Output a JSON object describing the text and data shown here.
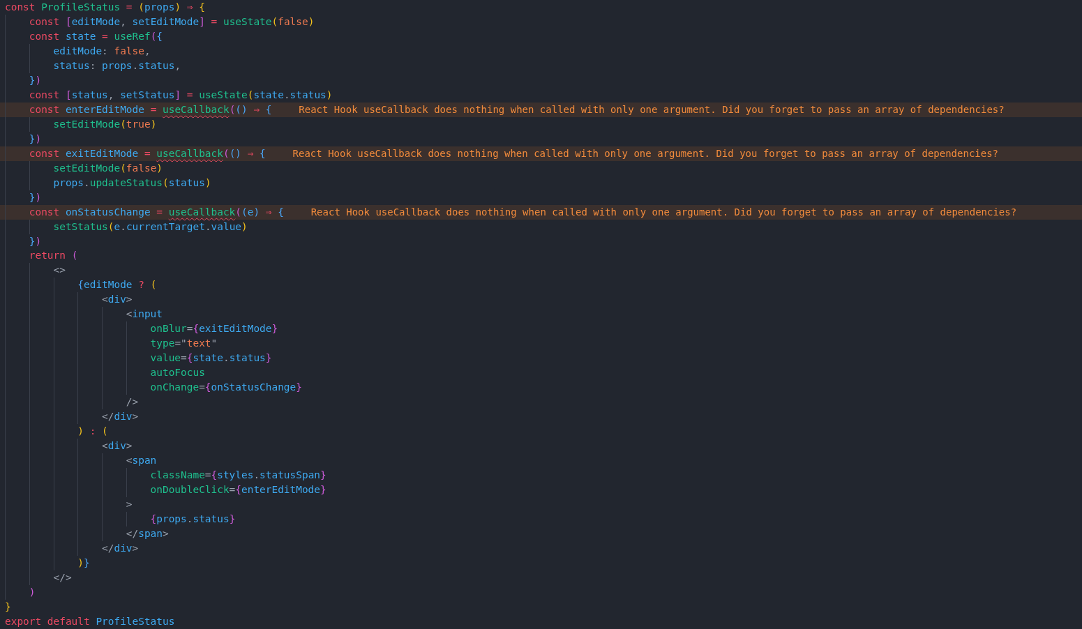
{
  "editor": {
    "lines": [
      {
        "tokens": [
          {
            "text": "const ",
            "kind": "kw"
          },
          {
            "text": "ProfileStatus ",
            "kind": "fn"
          },
          {
            "text": "= ",
            "kind": "op"
          },
          {
            "text": "(",
            "kind": "b1"
          },
          {
            "text": "props",
            "kind": "var"
          },
          {
            "text": ") ",
            "kind": "b1"
          },
          {
            "text": "⇒ ",
            "kind": "op"
          },
          {
            "text": "{",
            "kind": "b1"
          }
        ]
      },
      {
        "tokens": [
          {
            "text": "    const ",
            "kind": "kw"
          },
          {
            "text": "[",
            "kind": "b2"
          },
          {
            "text": "editMode",
            "kind": "var"
          },
          {
            "text": ", ",
            "kind": "punct"
          },
          {
            "text": "setEditMode",
            "kind": "var"
          },
          {
            "text": "] ",
            "kind": "b2"
          },
          {
            "text": "= ",
            "kind": "op"
          },
          {
            "text": "useState",
            "kind": "fn"
          },
          {
            "text": "(",
            "kind": "b1"
          },
          {
            "text": "false",
            "kind": "bool"
          },
          {
            "text": ")",
            "kind": "b1"
          }
        ]
      },
      {
        "tokens": [
          {
            "text": "    const ",
            "kind": "kw"
          },
          {
            "text": "state ",
            "kind": "var"
          },
          {
            "text": "= ",
            "kind": "op"
          },
          {
            "text": "useRef",
            "kind": "fn"
          },
          {
            "text": "(",
            "kind": "b2"
          },
          {
            "text": "{",
            "kind": "b3"
          }
        ]
      },
      {
        "tokens": [
          {
            "text": "        editMode",
            "kind": "var"
          },
          {
            "text": ": ",
            "kind": "punct"
          },
          {
            "text": "false",
            "kind": "bool"
          },
          {
            "text": ",",
            "kind": "punct"
          }
        ]
      },
      {
        "tokens": [
          {
            "text": "        status",
            "kind": "var"
          },
          {
            "text": ": ",
            "kind": "punct"
          },
          {
            "text": "props",
            "kind": "var"
          },
          {
            "text": ".",
            "kind": "punct"
          },
          {
            "text": "status",
            "kind": "var"
          },
          {
            "text": ",",
            "kind": "punct"
          }
        ]
      },
      {
        "tokens": [
          {
            "text": "    }",
            "kind": "b3"
          },
          {
            "text": ")",
            "kind": "b2"
          }
        ]
      },
      {
        "tokens": [
          {
            "text": "    const ",
            "kind": "kw"
          },
          {
            "text": "[",
            "kind": "b2"
          },
          {
            "text": "status",
            "kind": "var"
          },
          {
            "text": ", ",
            "kind": "punct"
          },
          {
            "text": "setStatus",
            "kind": "var"
          },
          {
            "text": "] ",
            "kind": "b2"
          },
          {
            "text": "= ",
            "kind": "op"
          },
          {
            "text": "useState",
            "kind": "fn"
          },
          {
            "text": "(",
            "kind": "b1"
          },
          {
            "text": "state",
            "kind": "var"
          },
          {
            "text": ".",
            "kind": "punct"
          },
          {
            "text": "status",
            "kind": "var"
          },
          {
            "text": ")",
            "kind": "b1"
          }
        ]
      },
      {
        "tokens": [
          {
            "text": "    const ",
            "kind": "kw"
          },
          {
            "text": "enterEditMode ",
            "kind": "var"
          },
          {
            "text": "= ",
            "kind": "op"
          },
          {
            "text": "useCallback",
            "kind": "flagged"
          },
          {
            "text": "(",
            "kind": "b2"
          },
          {
            "text": "() ",
            "kind": "b3"
          },
          {
            "text": "⇒ ",
            "kind": "op"
          },
          {
            "text": "{",
            "kind": "b3"
          }
        ],
        "warning": "React Hook useCallback does nothing when called with only one argument. Did you forget to pass an array of dependencies?"
      },
      {
        "tokens": [
          {
            "text": "        setEditMode",
            "kind": "fn"
          },
          {
            "text": "(",
            "kind": "b1"
          },
          {
            "text": "true",
            "kind": "bool"
          },
          {
            "text": ")",
            "kind": "b1"
          }
        ]
      },
      {
        "tokens": [
          {
            "text": "    }",
            "kind": "b3"
          },
          {
            "text": ")",
            "kind": "b2"
          }
        ]
      },
      {
        "tokens": [
          {
            "text": "    const ",
            "kind": "kw"
          },
          {
            "text": "exitEditMode ",
            "kind": "var"
          },
          {
            "text": "= ",
            "kind": "op"
          },
          {
            "text": "useCallback",
            "kind": "flagged"
          },
          {
            "text": "(",
            "kind": "b2"
          },
          {
            "text": "() ",
            "kind": "b3"
          },
          {
            "text": "⇒ ",
            "kind": "op"
          },
          {
            "text": "{",
            "kind": "b3"
          }
        ],
        "warning": "React Hook useCallback does nothing when called with only one argument. Did you forget to pass an array of dependencies?"
      },
      {
        "tokens": [
          {
            "text": "        setEditMode",
            "kind": "fn"
          },
          {
            "text": "(",
            "kind": "b1"
          },
          {
            "text": "false",
            "kind": "bool"
          },
          {
            "text": ")",
            "kind": "b1"
          }
        ]
      },
      {
        "tokens": [
          {
            "text": "        props",
            "kind": "var"
          },
          {
            "text": ".",
            "kind": "punct"
          },
          {
            "text": "updateStatus",
            "kind": "fn"
          },
          {
            "text": "(",
            "kind": "b1"
          },
          {
            "text": "status",
            "kind": "var"
          },
          {
            "text": ")",
            "kind": "b1"
          }
        ]
      },
      {
        "tokens": [
          {
            "text": "    }",
            "kind": "b3"
          },
          {
            "text": ")",
            "kind": "b2"
          }
        ]
      },
      {
        "tokens": [
          {
            "text": "    const ",
            "kind": "kw"
          },
          {
            "text": "onStatusChange ",
            "kind": "var"
          },
          {
            "text": "= ",
            "kind": "op"
          },
          {
            "text": "useCallback",
            "kind": "flagged"
          },
          {
            "text": "(",
            "kind": "b2"
          },
          {
            "text": "(",
            "kind": "b3"
          },
          {
            "text": "e",
            "kind": "var"
          },
          {
            "text": ") ",
            "kind": "b3"
          },
          {
            "text": "⇒ ",
            "kind": "op"
          },
          {
            "text": "{",
            "kind": "b3"
          }
        ],
        "warning": "React Hook useCallback does nothing when called with only one argument. Did you forget to pass an array of dependencies?"
      },
      {
        "tokens": [
          {
            "text": "        setStatus",
            "kind": "fn"
          },
          {
            "text": "(",
            "kind": "b1"
          },
          {
            "text": "e",
            "kind": "var"
          },
          {
            "text": ".",
            "kind": "punct"
          },
          {
            "text": "currentTarget",
            "kind": "var"
          },
          {
            "text": ".",
            "kind": "punct"
          },
          {
            "text": "value",
            "kind": "var"
          },
          {
            "text": ")",
            "kind": "b1"
          }
        ]
      },
      {
        "tokens": [
          {
            "text": "    }",
            "kind": "b3"
          },
          {
            "text": ")",
            "kind": "b2"
          }
        ]
      },
      {
        "tokens": [
          {
            "text": "    return ",
            "kind": "kw"
          },
          {
            "text": "(",
            "kind": "b2"
          }
        ]
      },
      {
        "tokens": [
          {
            "text": "        <>",
            "kind": "punct"
          }
        ]
      },
      {
        "tokens": [
          {
            "text": "            {",
            "kind": "b3"
          },
          {
            "text": "editMode ",
            "kind": "var"
          },
          {
            "text": "? ",
            "kind": "op"
          },
          {
            "text": "(",
            "kind": "b1"
          }
        ]
      },
      {
        "tokens": [
          {
            "text": "                <",
            "kind": "punct"
          },
          {
            "text": "div",
            "kind": "tag"
          },
          {
            "text": ">",
            "kind": "punct"
          }
        ]
      },
      {
        "tokens": [
          {
            "text": "                    <",
            "kind": "punct"
          },
          {
            "text": "input",
            "kind": "tag"
          }
        ]
      },
      {
        "tokens": [
          {
            "text": "                        onBlur",
            "kind": "attr"
          },
          {
            "text": "=",
            "kind": "punct"
          },
          {
            "text": "{",
            "kind": "b2"
          },
          {
            "text": "exitEditMode",
            "kind": "var"
          },
          {
            "text": "}",
            "kind": "b2"
          }
        ]
      },
      {
        "tokens": [
          {
            "text": "                        type",
            "kind": "attr"
          },
          {
            "text": "=\"",
            "kind": "punct"
          },
          {
            "text": "text",
            "kind": "str"
          },
          {
            "text": "\"",
            "kind": "punct"
          }
        ]
      },
      {
        "tokens": [
          {
            "text": "                        value",
            "kind": "attr"
          },
          {
            "text": "=",
            "kind": "punct"
          },
          {
            "text": "{",
            "kind": "b2"
          },
          {
            "text": "state",
            "kind": "var"
          },
          {
            "text": ".",
            "kind": "punct"
          },
          {
            "text": "status",
            "kind": "var"
          },
          {
            "text": "}",
            "kind": "b2"
          }
        ]
      },
      {
        "tokens": [
          {
            "text": "                        autoFocus",
            "kind": "attr"
          }
        ]
      },
      {
        "tokens": [
          {
            "text": "                        onChange",
            "kind": "attr"
          },
          {
            "text": "=",
            "kind": "punct"
          },
          {
            "text": "{",
            "kind": "b2"
          },
          {
            "text": "onStatusChange",
            "kind": "var"
          },
          {
            "text": "}",
            "kind": "b2"
          }
        ]
      },
      {
        "tokens": [
          {
            "text": "                    />",
            "kind": "punct"
          }
        ]
      },
      {
        "tokens": [
          {
            "text": "                </",
            "kind": "punct"
          },
          {
            "text": "div",
            "kind": "tag"
          },
          {
            "text": ">",
            "kind": "punct"
          }
        ]
      },
      {
        "tokens": [
          {
            "text": "            ) ",
            "kind": "b1"
          },
          {
            "text": ": ",
            "kind": "op"
          },
          {
            "text": "(",
            "kind": "b1"
          }
        ]
      },
      {
        "tokens": [
          {
            "text": "                <",
            "kind": "punct"
          },
          {
            "text": "div",
            "kind": "tag"
          },
          {
            "text": ">",
            "kind": "punct"
          }
        ]
      },
      {
        "tokens": [
          {
            "text": "                    <",
            "kind": "punct"
          },
          {
            "text": "span",
            "kind": "tag"
          }
        ]
      },
      {
        "tokens": [
          {
            "text": "                        className",
            "kind": "attr"
          },
          {
            "text": "=",
            "kind": "punct"
          },
          {
            "text": "{",
            "kind": "b2"
          },
          {
            "text": "styles",
            "kind": "var"
          },
          {
            "text": ".",
            "kind": "punct"
          },
          {
            "text": "statusSpan",
            "kind": "var"
          },
          {
            "text": "}",
            "kind": "b2"
          }
        ]
      },
      {
        "tokens": [
          {
            "text": "                        onDoubleClick",
            "kind": "attr"
          },
          {
            "text": "=",
            "kind": "punct"
          },
          {
            "text": "{",
            "kind": "b2"
          },
          {
            "text": "enterEditMode",
            "kind": "var"
          },
          {
            "text": "}",
            "kind": "b2"
          }
        ]
      },
      {
        "tokens": [
          {
            "text": "                    >",
            "kind": "punct"
          }
        ]
      },
      {
        "tokens": [
          {
            "text": "                        {",
            "kind": "b2"
          },
          {
            "text": "props",
            "kind": "var"
          },
          {
            "text": ".",
            "kind": "punct"
          },
          {
            "text": "status",
            "kind": "var"
          },
          {
            "text": "}",
            "kind": "b2"
          }
        ]
      },
      {
        "tokens": [
          {
            "text": "                    </",
            "kind": "punct"
          },
          {
            "text": "span",
            "kind": "tag"
          },
          {
            "text": ">",
            "kind": "punct"
          }
        ]
      },
      {
        "tokens": [
          {
            "text": "                </",
            "kind": "punct"
          },
          {
            "text": "div",
            "kind": "tag"
          },
          {
            "text": ">",
            "kind": "punct"
          }
        ]
      },
      {
        "tokens": [
          {
            "text": "            )",
            "kind": "b1"
          },
          {
            "text": "}",
            "kind": "b3"
          }
        ]
      },
      {
        "tokens": [
          {
            "text": "        </>",
            "kind": "punct"
          }
        ]
      },
      {
        "tokens": [
          {
            "text": "    )",
            "kind": "b2"
          }
        ]
      },
      {
        "tokens": [
          {
            "text": "}",
            "kind": "b1"
          }
        ]
      },
      {
        "tokens": [
          {
            "text": "export default ",
            "kind": "kw"
          },
          {
            "text": "ProfileStatus",
            "kind": "var"
          }
        ]
      }
    ]
  }
}
